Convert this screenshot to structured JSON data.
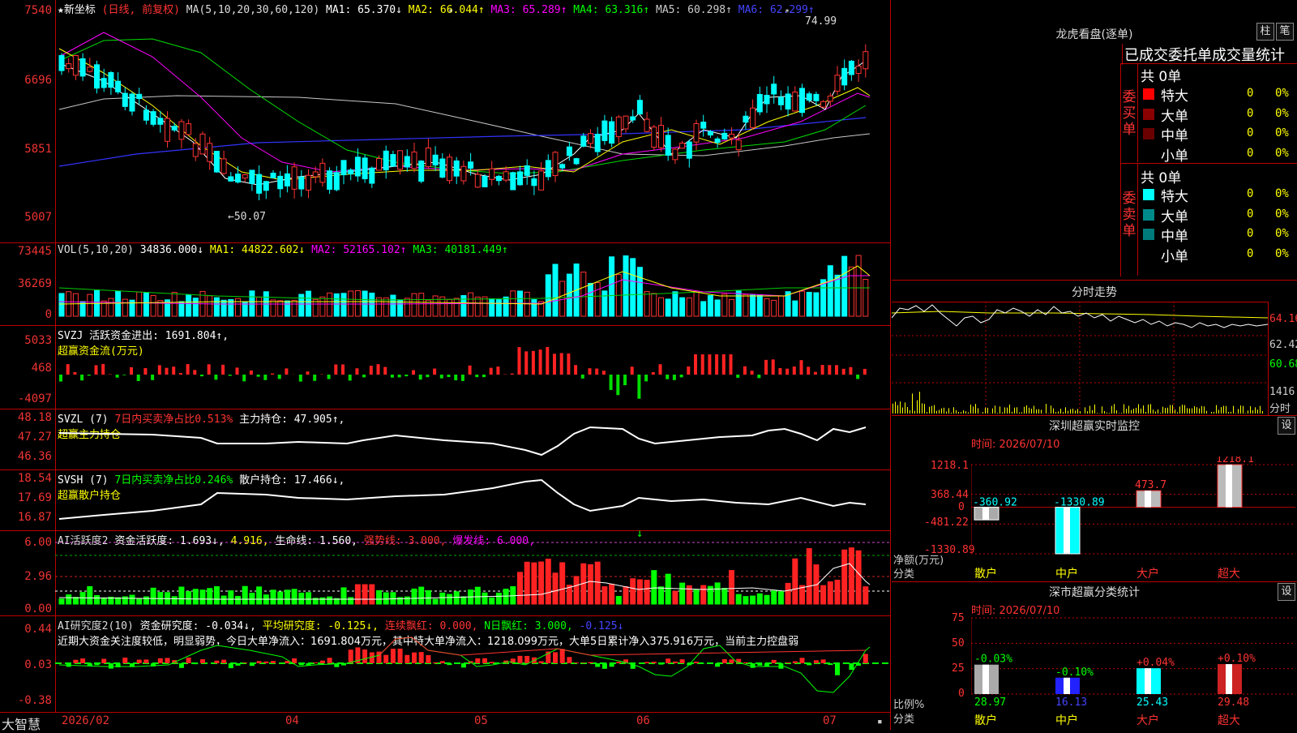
{
  "kline": {
    "title_star": "★新坐标",
    "period": "(日线, 前复权)",
    "ma_params": "MA(5,10,20,30,60,120)",
    "ma": [
      {
        "label": "MA1: 65.370↓",
        "color": "#ffffff"
      },
      {
        "label": "MA2: 66.044↑",
        "color": "#ffff00"
      },
      {
        "label": "MA3: 65.289↑",
        "color": "#ff00ff"
      },
      {
        "label": "MA4: 63.316↑",
        "color": "#00ff00"
      },
      {
        "label": "MA5: 60.298↑",
        "color": "#c8c8c8"
      },
      {
        "label": "MA6: 62.299↑",
        "color": "#4040ff"
      }
    ],
    "yticks": [
      "7540",
      "6696",
      "5851",
      "5007"
    ],
    "high_label": "74.99",
    "low_label": "←50.07"
  },
  "vol": {
    "legend_name": "VOL(5,10,20)",
    "value": "34836.000↓",
    "ma": [
      {
        "label": "MA1: 44822.602↓",
        "color": "#ffff00"
      },
      {
        "label": "MA2: 52165.102↑",
        "color": "#ff00ff"
      },
      {
        "label": "MA3: 40181.449↑",
        "color": "#00ff00"
      }
    ],
    "yticks": [
      "73445",
      "36269",
      "0"
    ]
  },
  "svzj": {
    "line1": "SVZJ  活跃资金进出: 1691.804↑,",
    "line2": "超赢资金流(万元)",
    "yticks": [
      "5033",
      "468",
      "-4097"
    ]
  },
  "svzl": {
    "name": "SVZL (7)",
    "ratio": "7日内买卖净占比0.513%",
    "holding": "主力持仓: 47.905↑,",
    "line2": "超赢主力持仓",
    "yticks": [
      "48.18",
      "47.27",
      "46.36"
    ]
  },
  "svsh": {
    "name": "SVSH (7)",
    "ratio": "7日内买卖净占比0.246%",
    "holding": "散户持仓: 17.466↓,",
    "line2": "超赢散户持仓",
    "yticks": [
      "18.54",
      "17.69",
      "16.87"
    ]
  },
  "ai_active": {
    "name": "AI活跃度2",
    "active": "资金活跃度: 1.693↓,",
    "v2": "4.916,",
    "life": "生命线: 1.560,",
    "strong": "强势线: 3.000,",
    "burst": "爆发线: 6.000,",
    "yticks": [
      "6.00",
      "2.96",
      "0.00"
    ]
  },
  "ai_research": {
    "name": "AI研究度2(10)",
    "research": "资金研究度: -0.034↓,",
    "avg": "平均研究度: -0.125↓,",
    "red": "连续飘红: 0.000,",
    "nred": "N日飘红: 3.000,",
    "val": "-0.125↓",
    "commentary": "近期大资金关注度较低，明显弱势，今日大单净流入：1691.804万元，其中特大单净流入：1218.099万元，大单5日累计净入375.916万元，当前主力控盘弱",
    "yticks": [
      "0.44",
      "0.03",
      "-0.38"
    ]
  },
  "xaxis": {
    "brand": "大智慧",
    "labels": [
      "2026/02",
      "04",
      "05",
      "06",
      "07"
    ]
  },
  "dragon": {
    "title": "龙虎看盘(逐单)",
    "btn1": "柱",
    "btn2": "笔",
    "tabs": "已成交委托单成交量统计",
    "buy_label": "委买单",
    "sell_label": "委卖单",
    "buy_total": "共 0单",
    "sell_total": "共 0单",
    "buy_rows": [
      {
        "name": "特大",
        "count": "0",
        "pct": "0%",
        "color": "#ff0000"
      },
      {
        "name": "大单",
        "count": "0",
        "pct": "0%",
        "color": "#8b0000"
      },
      {
        "name": "中单",
        "count": "0",
        "pct": "0%",
        "color": "#6b0000"
      },
      {
        "name": "小单",
        "count": "0",
        "pct": "0%",
        "color": ""
      }
    ],
    "sell_rows": [
      {
        "name": "特大",
        "count": "0",
        "pct": "0%",
        "color": "#00ffff"
      },
      {
        "name": "大单",
        "count": "0",
        "pct": "0%",
        "color": "#008b8b"
      },
      {
        "name": "中单",
        "count": "0",
        "pct": "0%",
        "color": "#007b7b"
      },
      {
        "name": "小单",
        "count": "0",
        "pct": "0%",
        "color": ""
      }
    ]
  },
  "intraday": {
    "title": "分时走势",
    "yticks": [
      "64.16",
      "62.42",
      "60.68"
    ],
    "vol_tick": "1416",
    "vol_unit": "分时"
  },
  "sz_monitor": {
    "title": "深圳超赢实时监控",
    "btn": "设",
    "time": "时间: 2026/07/10",
    "yticks": [
      "1218.1",
      "368.44",
      "0",
      "-481.22",
      "-1330.89"
    ],
    "ylabel1": "净额(万元)",
    "ylabel2": "分类",
    "chart_data": {
      "type": "bar",
      "categories": [
        "散户",
        "中户",
        "大户",
        "超大"
      ],
      "values": [
        -360.92,
        -1330.89,
        473.7,
        1218.1
      ],
      "ylim": [
        -1330.89,
        1218.1
      ]
    }
  },
  "sz_stats": {
    "title": "深市超赢分类统计",
    "btn": "设",
    "time": "时间: 2026/07/10",
    "yticks": [
      "75",
      "50",
      "25",
      "0"
    ],
    "ylabel1": "比例%",
    "ylabel2": "分类",
    "chart_data": {
      "type": "bar",
      "categories": [
        "散户",
        "中户",
        "大户",
        "超大"
      ],
      "values": [
        28.97,
        16.13,
        25.43,
        29.48
      ],
      "changes": [
        "-0.03%",
        "-0.10%",
        "+0.04%",
        "+0.10%"
      ],
      "ylim": [
        0,
        75
      ]
    }
  }
}
